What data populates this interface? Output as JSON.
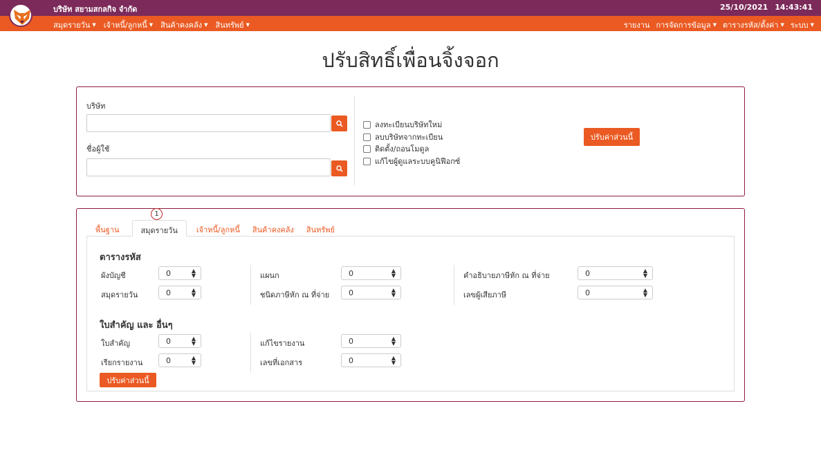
{
  "header": {
    "company": "บริษัท สยามสกลกิจ จำกัด",
    "date": "25/10/2021",
    "time": "14:43:41",
    "logo_icon": "fox-logo",
    "colors": {
      "topbar": "#7b2a5a",
      "navbar": "#ea5a22"
    }
  },
  "nav_left": [
    {
      "label": "สมุดรายวัน"
    },
    {
      "label": "เจ้าหนี้/ลูกหนี้"
    },
    {
      "label": "สินค้าคงคลัง"
    },
    {
      "label": "สินทรัพย์"
    }
  ],
  "nav_right": [
    {
      "label": "รายงาน"
    },
    {
      "label": "การจัดการข้อมูล"
    },
    {
      "label": "ตารางรหัส/ตั้งค่า"
    },
    {
      "label": "ระบบ"
    }
  ],
  "page_title": "ปรับสิทธิ์เพื่อนจิ้งจอก",
  "form": {
    "company_label": "บริษัท",
    "company_value": "",
    "user_label": "ชื่อผู้ใช้",
    "user_value": "",
    "checkboxes": [
      {
        "label": "ลงทะเบียนบริษัทใหม่",
        "checked": false
      },
      {
        "label": "ลบบริษัทจากทะเบียน",
        "checked": false
      },
      {
        "label": "ติดตั้ง/ถอนโมดูล",
        "checked": false
      },
      {
        "label": "แก้ไขผู้ดูแลระบบคูนิฟีอกซ์",
        "checked": false
      }
    ],
    "apply_label": "ปรับค่าส่วนนี้"
  },
  "tabs": [
    {
      "label": "พื้นฐาน",
      "active": false
    },
    {
      "label": "สมุดรายวัน",
      "active": true
    },
    {
      "label": "เจ้าหนี้/ลูกหนี้",
      "active": false
    },
    {
      "label": "สินค้าคงคลัง",
      "active": false
    },
    {
      "label": "สินทรัพย์",
      "active": false
    }
  ],
  "badge": "1",
  "codes": {
    "title": "ตารางรหัส",
    "rows": [
      {
        "label": "ผังบัญชี",
        "value": "0"
      },
      {
        "label": "สมุดรายวัน",
        "value": "0"
      },
      {
        "label": "แผนก",
        "value": "0"
      },
      {
        "label": "ชนิดภาษีหัก ณ ที่จ่าย",
        "value": "0"
      },
      {
        "label": "คำอธิบายภาษีหัก ณ ที่จ่าย",
        "value": "0"
      },
      {
        "label": "เลขผู้เสียภาษี",
        "value": "0"
      }
    ]
  },
  "docs": {
    "title": "ใบสำคัญ และ อื่นๆ",
    "rows": [
      {
        "label": "ใบสำคัญ",
        "value": "0"
      },
      {
        "label": "เรียกรายงาน",
        "value": "0"
      },
      {
        "label": "แก้ไขรายงาน",
        "value": "0"
      },
      {
        "label": "เลขที่เอกสาร",
        "value": "0"
      }
    ],
    "apply_label": "ปรับค่าส่วนนี้"
  }
}
